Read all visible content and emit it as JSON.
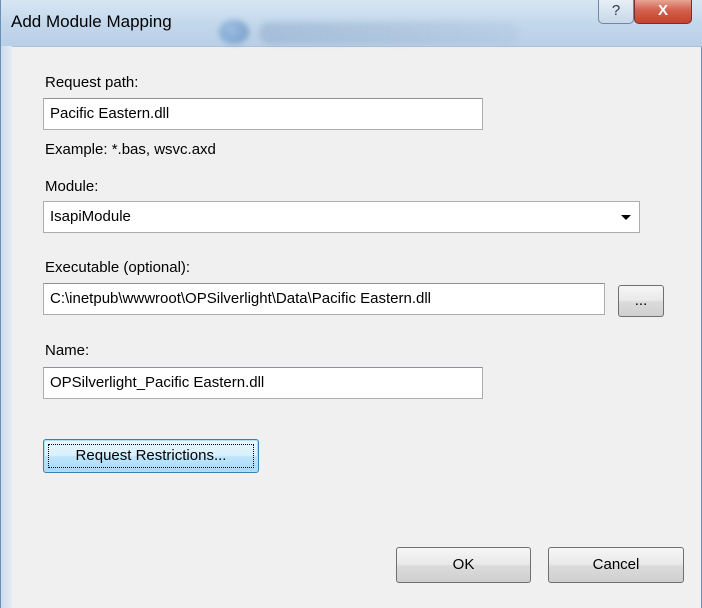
{
  "window": {
    "title": "Add Module Mapping",
    "help_label": "?",
    "close_label": "X"
  },
  "form": {
    "request_path_label": "Request path:",
    "request_path_value": "Pacific Eastern.dll",
    "request_path_example": "Example: *.bas, wsvc.axd",
    "module_label": "Module:",
    "module_value": "IsapiModule",
    "executable_label": "Executable (optional):",
    "executable_value": "C:\\inetpub\\wwwroot\\OPSilverlight\\Data\\Pacific Eastern.dll",
    "browse_label": "...",
    "name_label": "Name:",
    "name_value": "OPSilverlight_Pacific Eastern.dll",
    "request_restrictions_label": "Request Restrictions..."
  },
  "buttons": {
    "ok_label": "OK",
    "cancel_label": "Cancel"
  }
}
